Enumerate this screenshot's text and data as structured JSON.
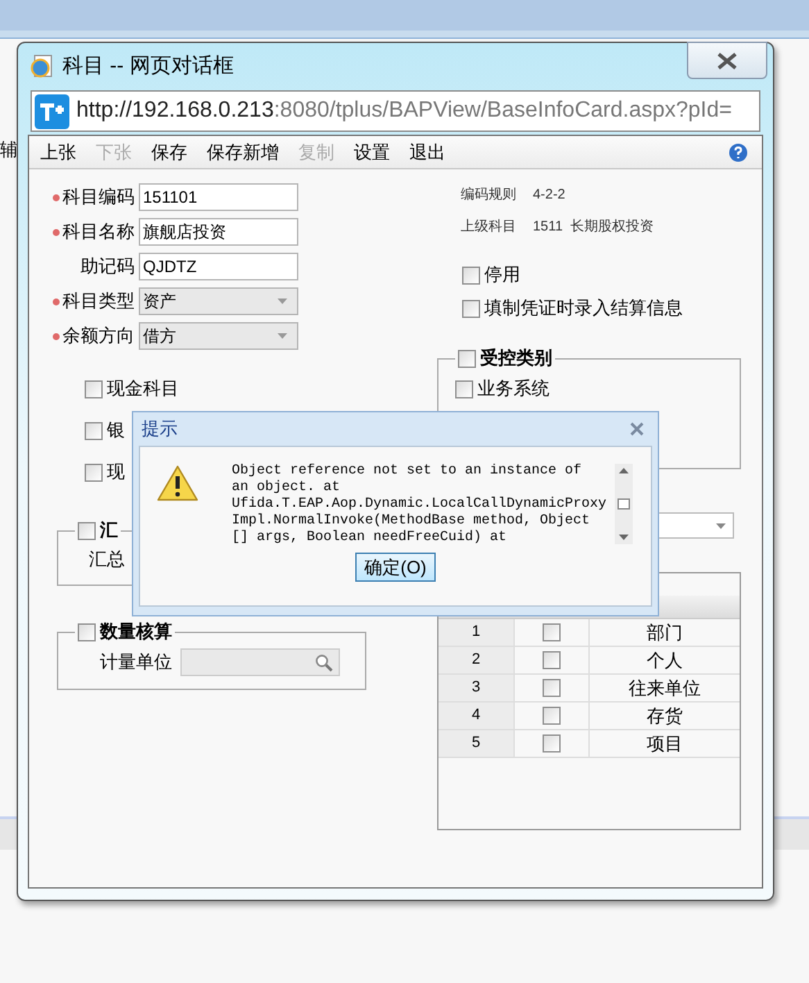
{
  "background": {
    "fragment": "辅"
  },
  "window": {
    "title": "科目 -- 网页对话框",
    "url_host": "http://192.168.0.213",
    "url_rest": ":8080/tplus/BAPView/BaseInfoCard.aspx?pId="
  },
  "toolbar": [
    {
      "label": "上张",
      "disabled": false
    },
    {
      "label": "下张",
      "disabled": true
    },
    {
      "label": "保存",
      "disabled": false
    },
    {
      "label": "保存新增",
      "disabled": false
    },
    {
      "label": "复制",
      "disabled": true
    },
    {
      "label": "设置",
      "disabled": false
    },
    {
      "label": "退出",
      "disabled": false
    }
  ],
  "fields": [
    {
      "label": "科目编码",
      "required": true,
      "kind": "text",
      "value": "151101"
    },
    {
      "label": "科目名称",
      "required": true,
      "kind": "text",
      "value": "旗舰店投资"
    },
    {
      "label": "助记码",
      "required": false,
      "kind": "text",
      "value": "QJDTZ"
    },
    {
      "label": "科目类型",
      "required": true,
      "kind": "select",
      "value": "资产"
    },
    {
      "label": "余额方向",
      "required": true,
      "kind": "select",
      "value": "借方"
    }
  ],
  "left_checks": [
    {
      "label": "现金科目",
      "checked": false
    },
    {
      "label": "银",
      "checked": false
    },
    {
      "label": "现",
      "checked": false
    }
  ],
  "info": [
    {
      "label": "编码规则",
      "value": "4-2-2"
    },
    {
      "label": "上级科目",
      "value": "1511  长期股权投资"
    }
  ],
  "right_checks": [
    {
      "label": "停用",
      "checked": false
    },
    {
      "label": "填制凭证时录入结算信息",
      "checked": false
    }
  ],
  "controlled": {
    "label": "受控类别",
    "checked": false,
    "items": [
      {
        "label": "业务系统",
        "checked": false
      }
    ]
  },
  "summary": {
    "label": "汇",
    "checked": false,
    "sub_label": "汇总"
  },
  "quantity": {
    "label": "数量核算",
    "checked": false,
    "unit_label": "计量单位"
  },
  "aux_table": {
    "rows": [
      {
        "no": "1",
        "checked": false,
        "item": "部门"
      },
      {
        "no": "2",
        "checked": false,
        "item": "个人"
      },
      {
        "no": "3",
        "checked": false,
        "item": "往来单位"
      },
      {
        "no": "4",
        "checked": false,
        "item": "存货"
      },
      {
        "no": "5",
        "checked": false,
        "item": "项目"
      }
    ]
  },
  "alert": {
    "title": "提示",
    "lines": [
      "Object reference not set to an instance of",
      "an object. at",
      "Ufida.T.EAP.Aop.Dynamic.LocalCallDynamicProxy",
      "Impl.NormalInvoke(MethodBase method, Object",
      "[] args, Boolean needFreeCuid) at"
    ],
    "button": "确定(O)"
  }
}
